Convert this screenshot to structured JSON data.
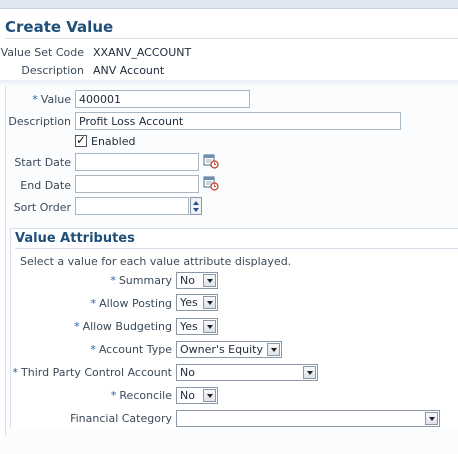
{
  "page": {
    "title": "Create Value"
  },
  "header": {
    "value_set_code_label": "Value Set Code",
    "value_set_code": "XXANV_ACCOUNT",
    "description_label": "Description",
    "description": "ANV Account"
  },
  "form": {
    "value_label": "Value",
    "value": "400001",
    "description_label": "Description",
    "description": "Profit Loss Account",
    "enabled_label": "Enabled",
    "enabled": true,
    "start_date_label": "Start Date",
    "start_date": "",
    "end_date_label": "End Date",
    "end_date": "",
    "sort_order_label": "Sort Order",
    "sort_order": "",
    "required_marker": "*"
  },
  "attributes": {
    "title": "Value Attributes",
    "instruction": "Select a value for each value attribute displayed.",
    "summary_label": "Summary",
    "summary": "No",
    "allow_posting_label": "Allow Posting",
    "allow_posting": "Yes",
    "allow_budgeting_label": "Allow Budgeting",
    "allow_budgeting": "Yes",
    "account_type_label": "Account Type",
    "account_type": "Owner's Equity",
    "third_party_label": "Third Party Control Account",
    "third_party": "No",
    "reconcile_label": "Reconcile",
    "reconcile": "No",
    "financial_category_label": "Financial Category",
    "financial_category": ""
  },
  "icons": {
    "date_picker": "calendar-icon",
    "stepper": "spinner-icon",
    "dropdown": "chevron-down-icon"
  },
  "colors": {
    "title": "#1f4e79",
    "required": "#1f5fa8",
    "top_bar": "#dfe8f2"
  }
}
